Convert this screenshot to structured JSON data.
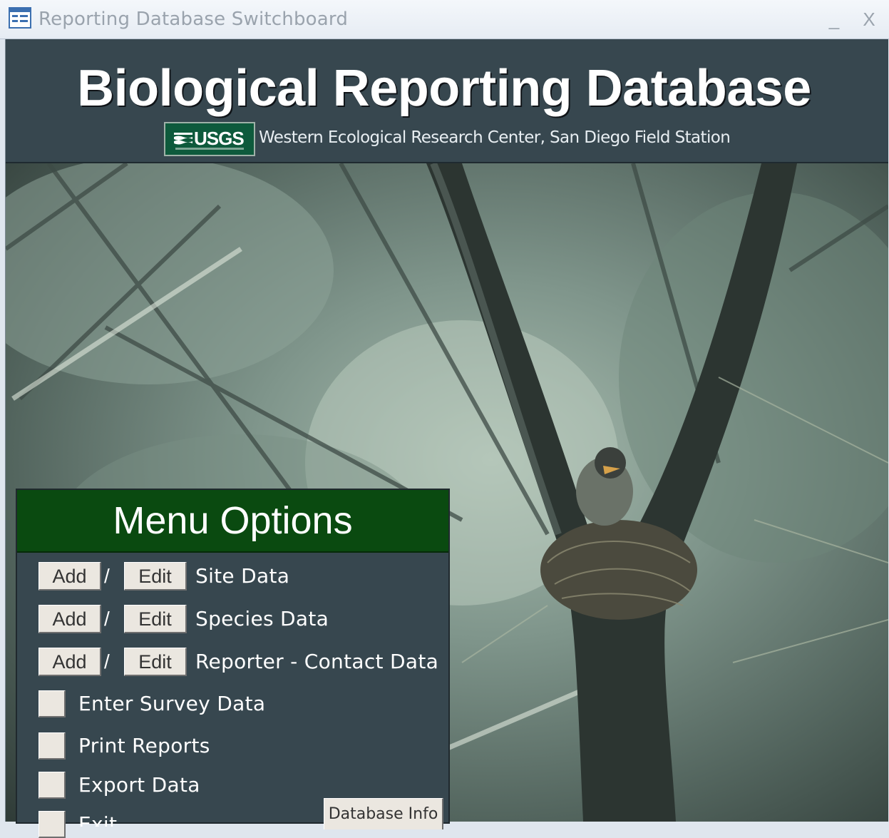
{
  "window": {
    "title": "Reporting Database Switchboard",
    "minimize_glyph": "_",
    "close_glyph": "X"
  },
  "header": {
    "title": "Biological Reporting Database",
    "logo_text": "USGS",
    "subtitle": "Western Ecological Research Center, San Diego Field Station"
  },
  "menu": {
    "title": "Menu Options",
    "data_rows": [
      {
        "add_label": "Add",
        "separator": "/",
        "edit_label": "Edit",
        "label": "Site Data"
      },
      {
        "add_label": "Add",
        "separator": "/",
        "edit_label": "Edit",
        "label": "Species Data"
      },
      {
        "add_label": "Add",
        "separator": "/",
        "edit_label": "Edit",
        "label": "Reporter - Contact Data"
      }
    ],
    "options": [
      {
        "label": "Enter Survey Data"
      },
      {
        "label": "Print Reports"
      },
      {
        "label": "Export Data"
      },
      {
        "label": "Exit"
      }
    ],
    "database_info_label": "Database Info"
  },
  "colors": {
    "header_band": "#37474f",
    "menu_header": "#0a4a10",
    "usgs_green": "#0e5a3c",
    "button_face": "#ebe7e0"
  },
  "icons": {
    "app": "switchboard-form-icon",
    "logo": "usgs-logo",
    "photo": "bird-nest-photo"
  }
}
